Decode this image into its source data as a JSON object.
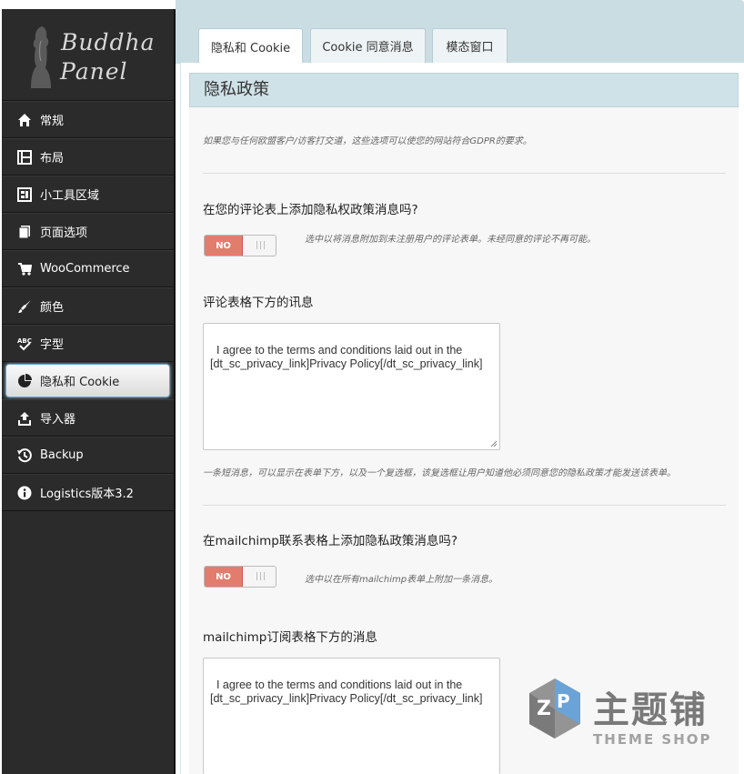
{
  "brand": {
    "line1": "Buddha",
    "line2": "Panel"
  },
  "sidebar": {
    "items": [
      {
        "label": "常规",
        "icon": "home-icon"
      },
      {
        "label": "布局",
        "icon": "layout-icon"
      },
      {
        "label": "小工具区域",
        "icon": "widgets-icon"
      },
      {
        "label": "页面选项",
        "icon": "pages-icon"
      },
      {
        "label": "WooCommerce",
        "icon": "cart-icon"
      },
      {
        "label": "颜色",
        "icon": "brush-icon"
      },
      {
        "label": "字型",
        "icon": "typography-icon"
      },
      {
        "label": "隐私和 Cookie",
        "icon": "pie-chart-icon",
        "active": true
      },
      {
        "label": "导入器",
        "icon": "import-icon"
      },
      {
        "label": "Backup",
        "icon": "history-icon"
      },
      {
        "label": "Logistics版本3.2",
        "icon": "info-icon"
      }
    ]
  },
  "tabs": [
    "隐私和 Cookie",
    "Cookie 同意消息",
    "模态窗口"
  ],
  "section": {
    "title": "隐私政策",
    "intro": "如果您与任何欧盟客户/访客打交道，这些选项可以使您的网站符合GDPR的要求。"
  },
  "comment_privacy": {
    "question": "在您的评论表上添加隐私权政策消息吗?",
    "toggle": "NO",
    "hint": "选中以将消息附加到未注册用户的评论表单。未经同意的评论不再可能。"
  },
  "comment_message": {
    "label": "评论表格下方的讯息",
    "value": "I agree to the terms and conditions laid out in the [dt_sc_privacy_link]Privacy Policy[/dt_sc_privacy_link]",
    "hint": "一条短消息，可以显示在表单下方，以及一个复选框，该复选框让用户知道他必须同意您的隐私政策才能发送该表单。"
  },
  "mailchimp_privacy": {
    "question": "在mailchimp联系表格上添加隐私政策消息吗?",
    "toggle": "NO",
    "hint": "选中以在所有mailchimp表单上附加一条消息。"
  },
  "mailchimp_message": {
    "label": "mailchimp订阅表格下方的消息",
    "value": "I agree to the terms and conditions laid out in the [dt_sc_privacy_link]Privacy Policy[/dt_sc_privacy_link]"
  },
  "watermark": {
    "cn": "主题铺",
    "en": "THEME SHOP"
  },
  "colors": {
    "sidebar": "#2b2b2b",
    "accent": "#c9dde3",
    "toggle_off": "#e27d6d"
  }
}
